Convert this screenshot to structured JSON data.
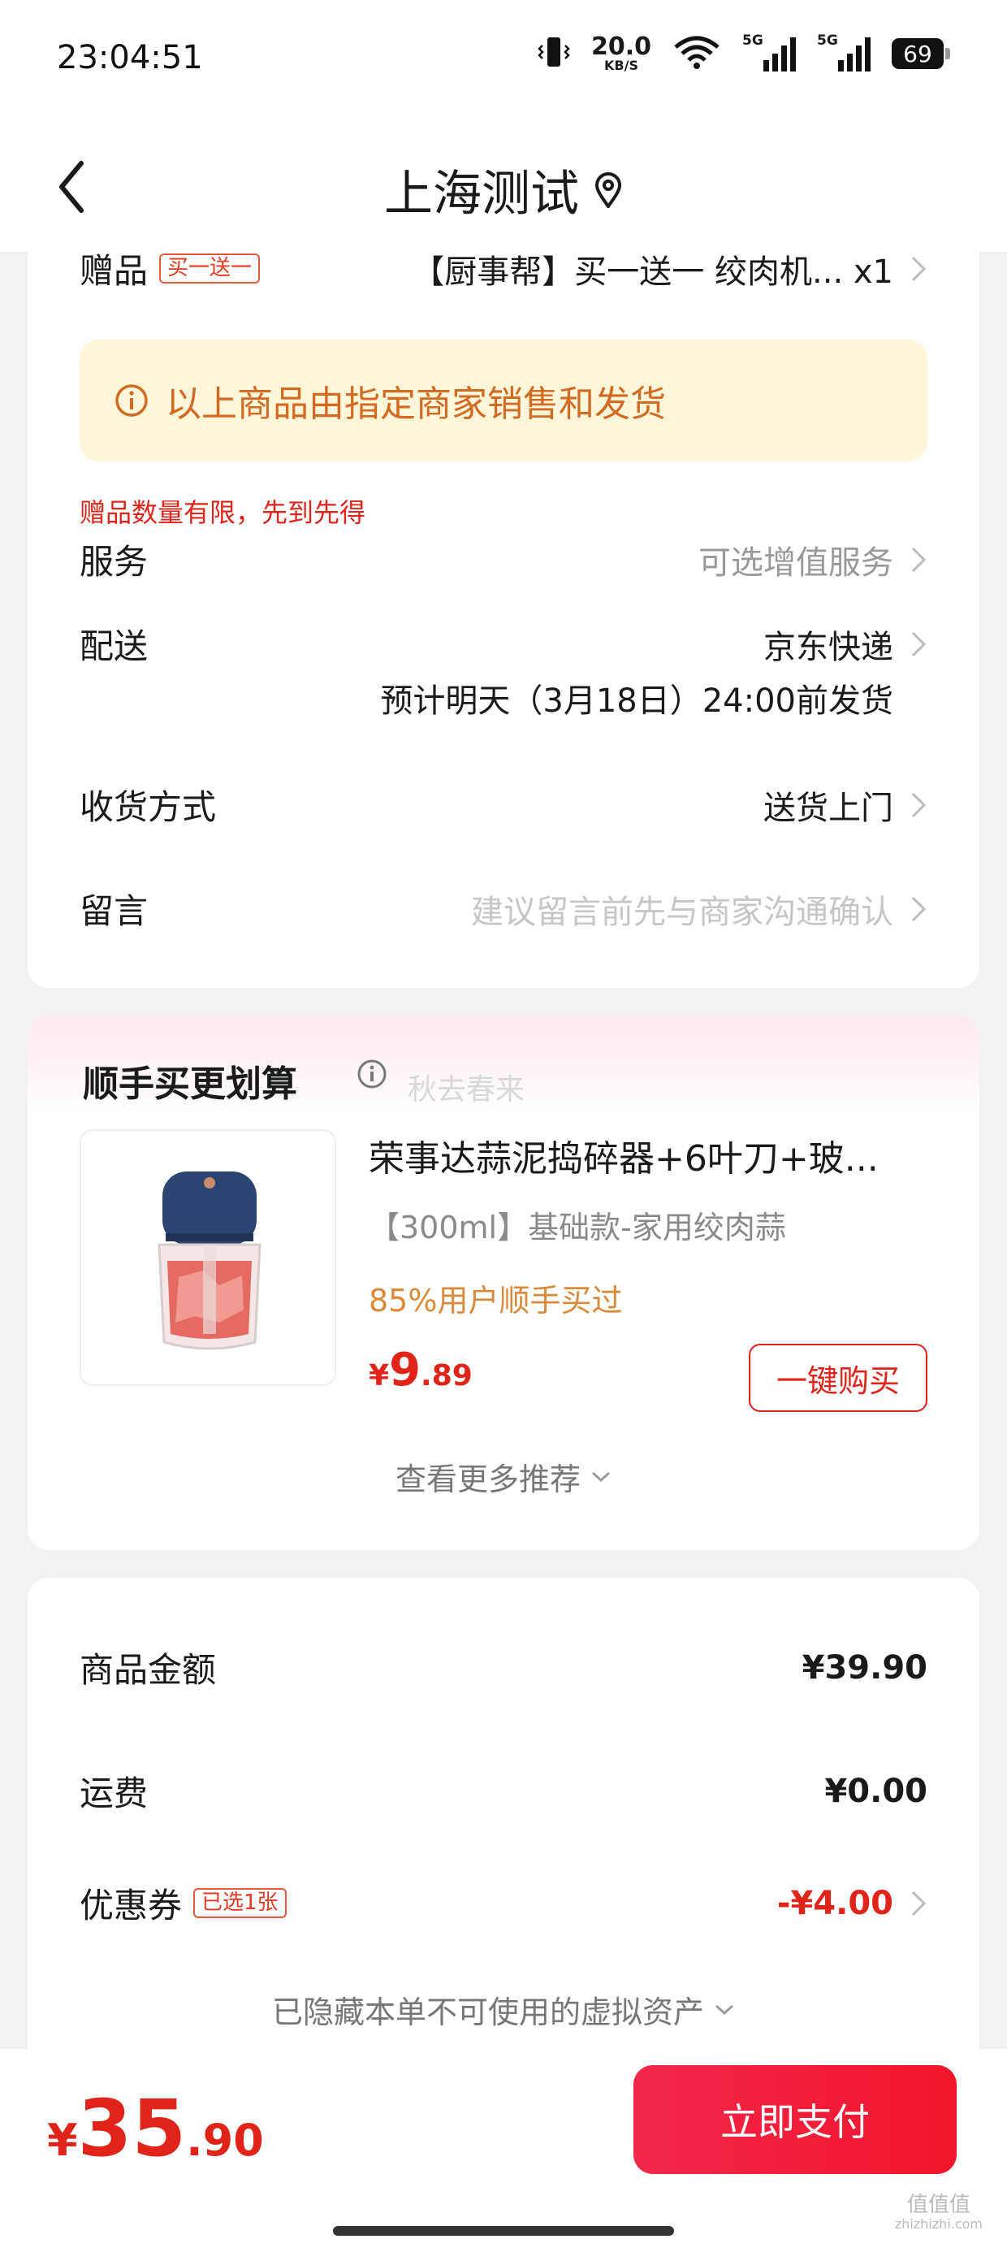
{
  "status_bar": {
    "time": "23:04:51",
    "net_speed": "20.0",
    "net_unit": "KB/S",
    "signal1": "5G",
    "signal2": "5G",
    "battery": "69"
  },
  "nav": {
    "title": "上海测试"
  },
  "order_detail": {
    "gift_label": "赠品",
    "gift_tag": "买一送一",
    "gift_value": "【厨事帮】买一送一 绞肉机... x1",
    "notice": "以上商品由指定商家销售和发货",
    "limit_note": "赠品数量有限，先到先得",
    "service_label": "服务",
    "service_value": "可选增值服务",
    "delivery_label": "配送",
    "delivery_value": "京东快递",
    "delivery_eta": "预计明天（3月18日）24:00前发货",
    "receive_label": "收货方式",
    "receive_value": "送货上门",
    "note_label": "留言",
    "note_placeholder": "建议留言前先与商家沟通确认"
  },
  "recommend": {
    "title": "顺手买更划算",
    "watermark": "秋去春来",
    "product_name": "荣事达蒜泥捣碎器+6叶刀+玻...",
    "product_spec": "【300ml】基础款-家用绞肉蒜",
    "product_pct": "85%用户顺手买过",
    "price_currency": "¥",
    "price_int": "9",
    "price_dec": ".89",
    "buy_label": "一键购买",
    "more_label": "查看更多推荐"
  },
  "summary": {
    "goods_label": "商品金额",
    "goods_value": "¥39.90",
    "shipping_label": "运费",
    "shipping_value": "¥0.00",
    "coupon_label": "优惠券",
    "coupon_tag": "已选1张",
    "coupon_value": "-¥4.00",
    "hidden_assets": "已隐藏本单不可使用的虚拟资产"
  },
  "bottom": {
    "total_currency": "¥",
    "total_int": "35",
    "total_dec": ".90",
    "pay_label": "立即支付"
  },
  "site_watermark": "值值值",
  "site_watermark_sub": "zhizhizhi.com"
}
